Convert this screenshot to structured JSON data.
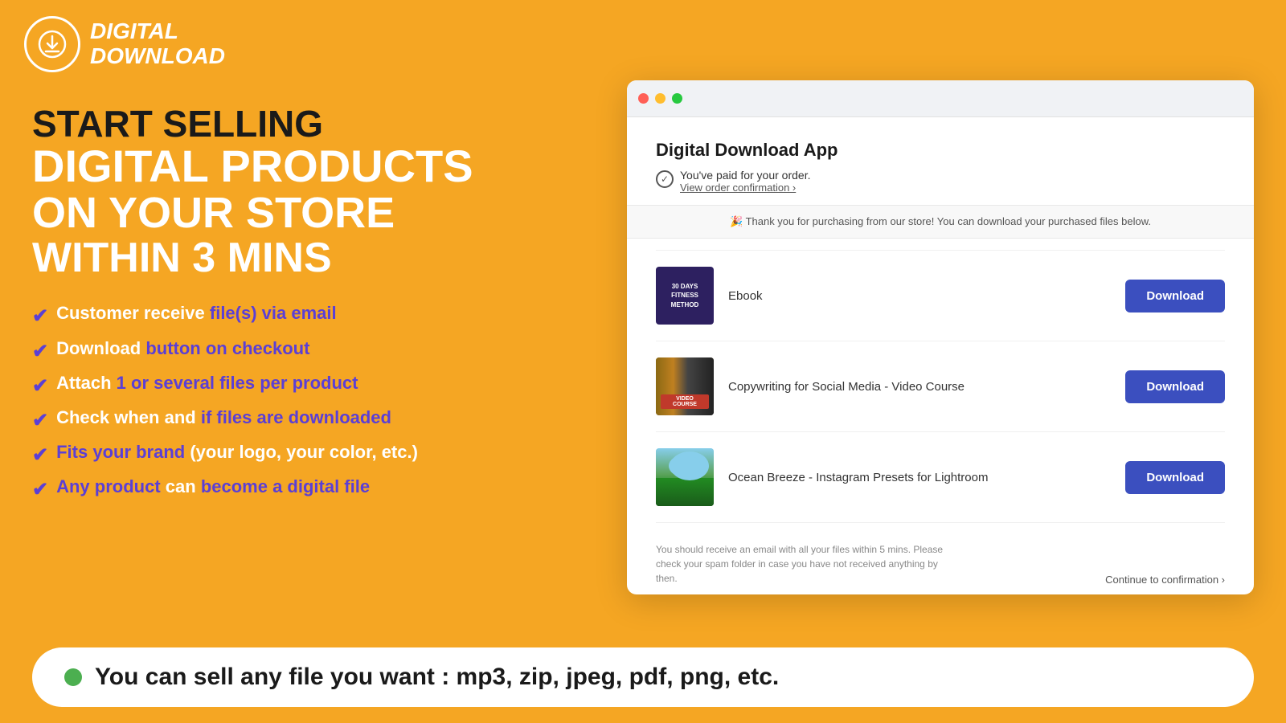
{
  "logo": {
    "line1": "DIGITAL",
    "line2": "DOWNLOAD"
  },
  "headline": {
    "line1": "START SELLING",
    "line2": "DIGITAL PRODUCTS",
    "line3": "ON YOUR STORE",
    "line4": "WITHIN 3 MINS"
  },
  "features": [
    {
      "prefix": "Customer receive ",
      "highlight": "file(s) via email",
      "suffix": ""
    },
    {
      "prefix": "Download ",
      "highlight": "button on checkout",
      "suffix": ""
    },
    {
      "prefix": "Attach ",
      "highlight": "1 or several files per product",
      "suffix": ""
    },
    {
      "prefix": "Check when and ",
      "highlight": "if files are downloaded",
      "suffix": ""
    },
    {
      "prefix": "",
      "highlight": "Fits your brand",
      "suffix": " (your logo, your color, etc.)"
    },
    {
      "prefix": "",
      "highlight": "Any product",
      "suffix": " can ",
      "highlight2": "become a digital file",
      "suffix2": ""
    }
  ],
  "browser": {
    "app_title": "Digital Download App",
    "paid_text": "You've paid for your order.",
    "confirm_link": "View order confirmation ›",
    "thank_you": "🎉 Thank you for purchasing from our store! You can download your purchased files below.",
    "products": [
      {
        "name": "Ebook",
        "thumb_type": "ebook",
        "thumb_text": "30 DAYS\nFITNESS\nMETHOD",
        "download_label": "Download"
      },
      {
        "name": "Copywriting for Social Media - Video Course",
        "thumb_type": "video",
        "thumb_text": "",
        "download_label": "Download"
      },
      {
        "name": "Ocean Breeze - Instagram Presets for Lightroom",
        "thumb_type": "nature",
        "thumb_text": "",
        "download_label": "Download"
      }
    ],
    "footer_note": "You should receive an email with all your files within 5 mins. Please check your spam folder in case you have not received anything by then.",
    "continue_link": "Continue to confirmation ›"
  },
  "bottom_banner": {
    "text": "You can sell any file you want : mp3, zip, jpeg, pdf, png, etc."
  }
}
